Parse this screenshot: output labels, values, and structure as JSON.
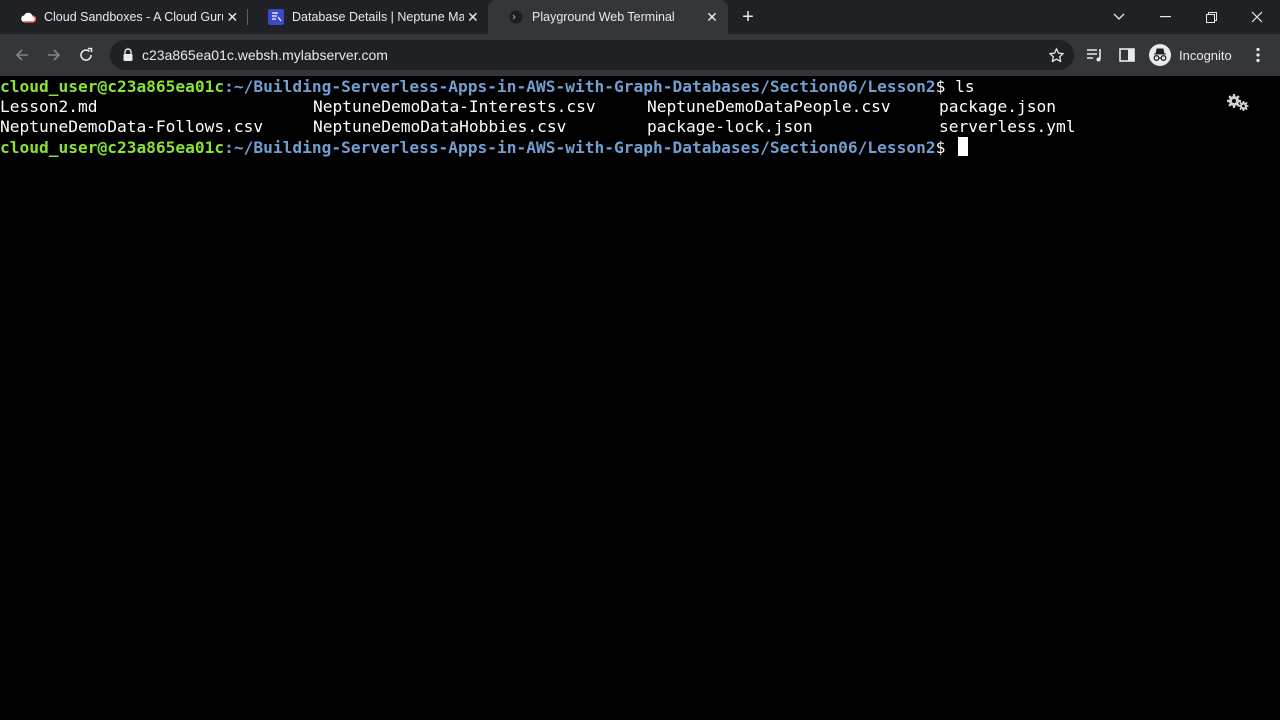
{
  "browser": {
    "tabs": [
      {
        "title": "Cloud Sandboxes - A Cloud Guru",
        "icon": "cloud-icon"
      },
      {
        "title": "Database Details | Neptune Mana",
        "icon": "neptune-icon"
      },
      {
        "title": "Playground Web Terminal",
        "icon": "terminal-icon",
        "active": true
      }
    ],
    "new_tab": "+",
    "close_glyph": "✕",
    "url": "c23a865ea01c.websh.mylabserver.com",
    "profile_label": "Incognito"
  },
  "terminal": {
    "prompt_user_host": "cloud_user@c23a865ea01c",
    "prompt_path": ":~/Building-Serverless-Apps-in-AWS-with-Graph-Databases/Section06/Lesson2",
    "prompt_suffix": "$ ",
    "command": "ls",
    "files": [
      [
        "Lesson2.md",
        "NeptuneDemoData-Interests.csv",
        "NeptuneDemoDataPeople.csv",
        "package.json"
      ],
      [
        "NeptuneDemoData-Follows.csv",
        "NeptuneDemoDataHobbies.csv",
        "package-lock.json",
        "serverless.yml"
      ]
    ]
  },
  "colors": {
    "prompt_user": "#8ae234",
    "prompt_path": "#729fcf",
    "terminal_bg": "#000000"
  }
}
